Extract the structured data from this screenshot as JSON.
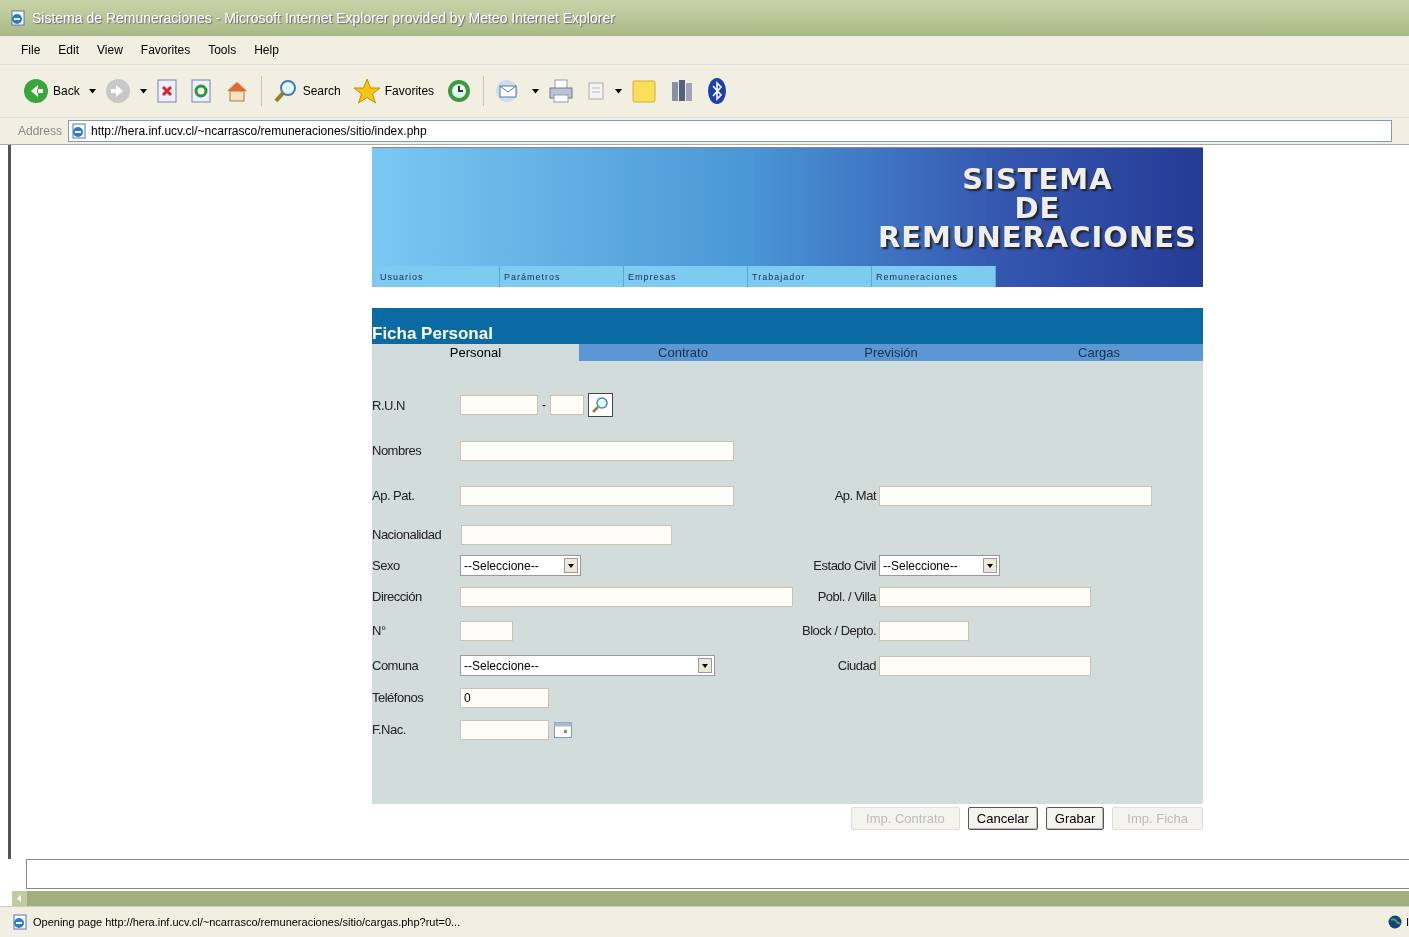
{
  "window": {
    "title": "Sistema de Remuneraciones - Microsoft Internet Explorer provided by Meteo Internet Explorer"
  },
  "menu": [
    "File",
    "Edit",
    "View",
    "Favorites",
    "Tools",
    "Help"
  ],
  "toolbar": {
    "back_label": "Back",
    "search_label": "Search",
    "favorites_label": "Favorites"
  },
  "address": {
    "label": "Address",
    "url": "http://hera.inf.ucv.cl/~ncarrasco/remuneraciones/sitio/index.php"
  },
  "banner": {
    "title_lines": [
      "SISTEMA",
      "DE",
      "REMUNERACIONES"
    ],
    "nav": [
      {
        "label": "Usuarios"
      },
      {
        "label": "Parámetros"
      },
      {
        "label": "Empresas"
      },
      {
        "label": "Trabajador"
      },
      {
        "label": "Remuneraciones"
      }
    ]
  },
  "form": {
    "title": "Ficha Personal",
    "tabs": [
      {
        "label": "Personal",
        "selected": true
      },
      {
        "label": "Contrato",
        "selected": false
      },
      {
        "label": "Previsión",
        "selected": false
      },
      {
        "label": "Cargas",
        "selected": false
      }
    ],
    "rows": [
      {
        "left": {
          "label": "R.U.N",
          "kind": "run",
          "separator": "-"
        }
      },
      {
        "left": {
          "label": "Nombres",
          "kind": "text"
        }
      },
      {
        "left": {
          "label": "Ap. Pat.",
          "kind": "text"
        },
        "right": {
          "label": "Ap. Mat",
          "kind": "text"
        }
      },
      {
        "left": {
          "label": "Nacionalidad",
          "kind": "text"
        }
      },
      {
        "left": {
          "label": "Sexo",
          "kind": "select",
          "value": "--Seleccione--"
        },
        "right": {
          "label": "Estado Civil",
          "kind": "select",
          "value": "--Seleccione--"
        }
      },
      {
        "left": {
          "label": "Dirección",
          "kind": "text"
        },
        "right": {
          "label": "Pobl. / Villa",
          "kind": "text"
        }
      },
      {
        "left": {
          "label": "N°",
          "kind": "text"
        },
        "right": {
          "label": "Block / Depto.",
          "kind": "text"
        }
      },
      {
        "left": {
          "label": "Comuna",
          "kind": "select",
          "value": "--Seleccione--"
        },
        "right": {
          "label": "Ciudad",
          "kind": "text"
        }
      },
      {
        "left": {
          "label": "Teléfonos",
          "kind": "text",
          "value": "0"
        }
      },
      {
        "left": {
          "label": "F.Nac.",
          "kind": "date"
        }
      }
    ],
    "buttons": [
      {
        "label": "Imp. Contrato",
        "disabled": true
      },
      {
        "label": "Cancelar",
        "disabled": false
      },
      {
        "label": "Grabar",
        "disabled": false
      },
      {
        "label": "Imp. Ficha",
        "disabled": true
      }
    ]
  },
  "status_bar": {
    "text": "Opening page http://hera.inf.ucv.cl/~ncarrasco/remuneraciones/sitio/cargas.php?rut=0...",
    "zone": "I"
  }
}
